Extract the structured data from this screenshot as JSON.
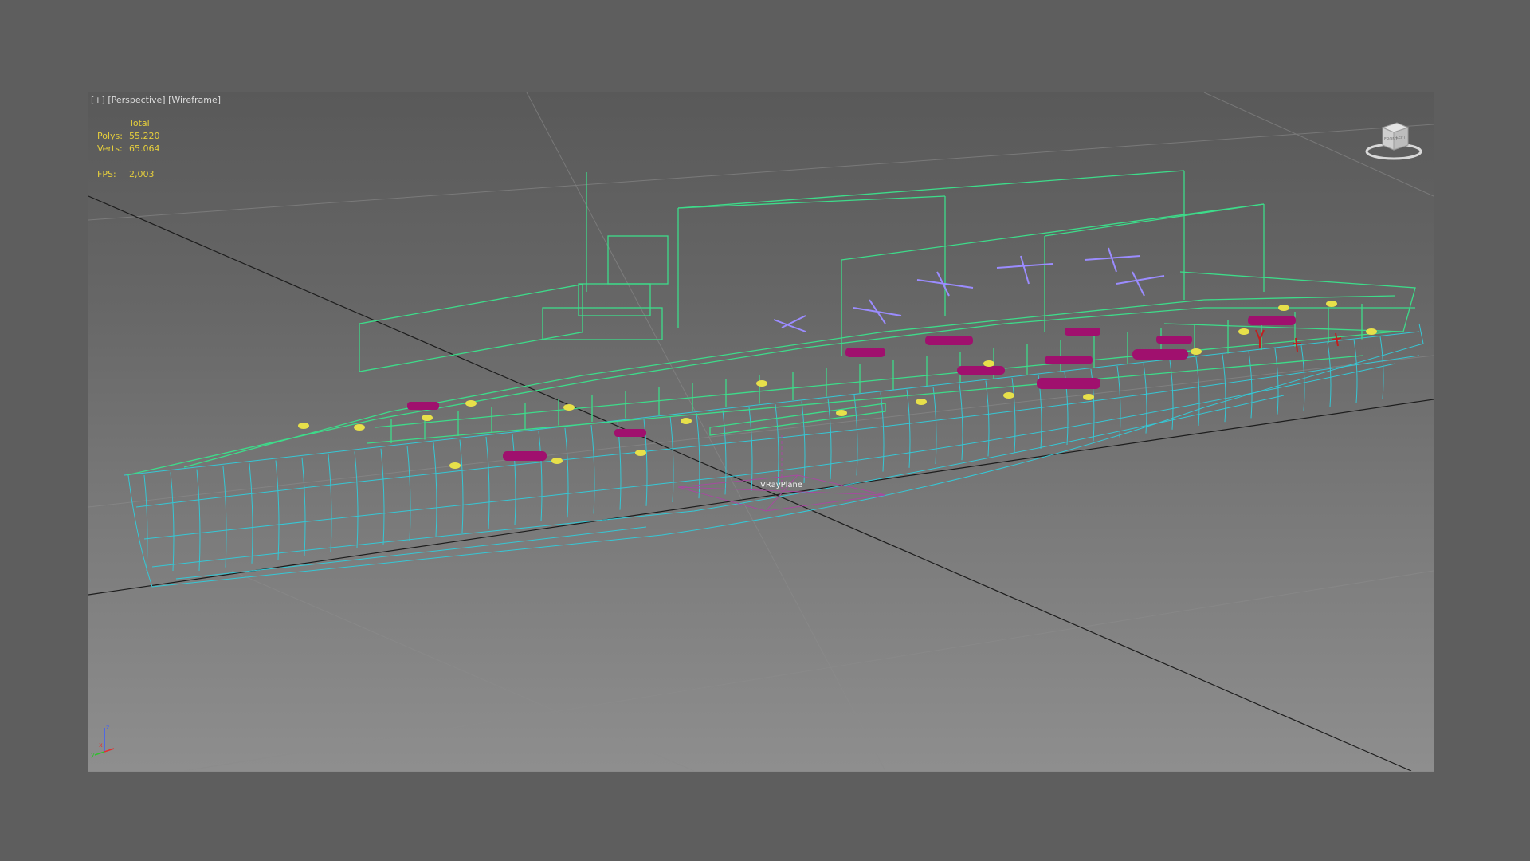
{
  "viewport": {
    "label_plus": "[+]",
    "label_view": "[Perspective]",
    "label_shading": "[Wireframe]"
  },
  "stats": {
    "header": "Total",
    "polys_label": "Polys:",
    "polys_value": "55.220",
    "verts_label": "Verts:",
    "verts_value": "65.064",
    "fps_label": "FPS:",
    "fps_value": "2,003"
  },
  "viewcube": {
    "face_left": "FRONT",
    "face_right": "LEFT"
  },
  "scene": {
    "helper_object_label": "VRayPlane"
  },
  "axis": {
    "x": "x",
    "y": "y",
    "z": "z"
  },
  "colors": {
    "hull": "#35c8d6",
    "superstructure": "#3ddc8a",
    "aircraft": "#9b8cff",
    "boats": "#a0106e",
    "lifebuoys": "#e7e04a",
    "figures": "#c31e1e",
    "stats_text": "#e6cf3c",
    "background": "#5e5e5e"
  }
}
